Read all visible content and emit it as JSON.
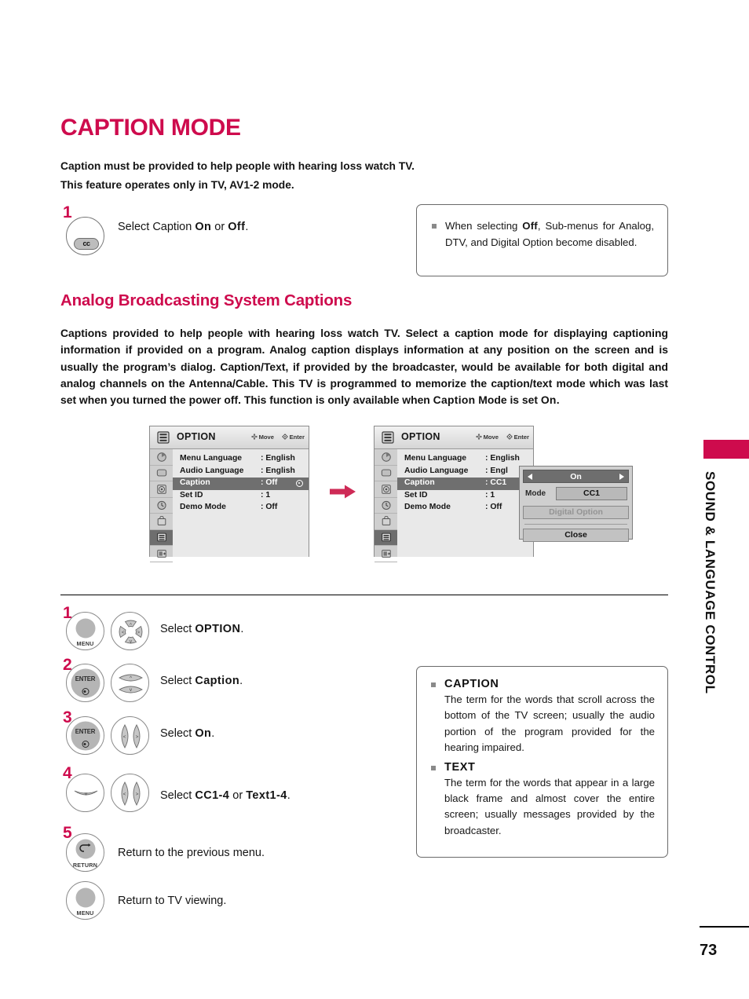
{
  "colors": {
    "accent": "#CE0B4D",
    "osd_highlight": "#6F6F6F",
    "text": "#151515"
  },
  "header": {
    "title": "CAPTION MODE"
  },
  "intro": {
    "line1": "Caption must be provided to help people with hearing loss watch TV.",
    "line2": "This feature operates only in TV, AV1-2 mode."
  },
  "top_step": {
    "number": "1",
    "button_label": "cc",
    "instruction_prefix": "Select Caption ",
    "instruction_on": "On",
    "instruction_mid": " or ",
    "instruction_off": "Off",
    "instruction_suffix": "."
  },
  "note_top": {
    "text_a": "When selecting ",
    "bold": "Off",
    "text_b": ", Sub-menus for Analog, DTV, and Digital Option become disabled."
  },
  "section": {
    "title": "Analog Broadcasting System Captions",
    "paragraph_a": "Captions provided to help people with hearing loss watch TV. Select a caption mode for displaying captioning information if provided on a program. Analog caption displays information at any position on the screen and is usually the program’s dialog. Caption/Text, if provided by the broadcaster, would be available for both digital and analog channels on the Antenna/Cable. This TV is programmed to memorize the caption/text mode which was last set when you turned the power off. This function is only available when ",
    "paragraph_bold1": "Caption",
    "paragraph_b": " Mode is set ",
    "paragraph_bold2": "On",
    "paragraph_c": "."
  },
  "osd": {
    "title": "OPTION",
    "hint_move": "Move",
    "hint_enter": "Enter",
    "rail_icons": [
      "picture-icon",
      "screen-icon",
      "audio-icon",
      "time-icon",
      "lock-icon",
      "option-icon",
      "input-icon"
    ],
    "rail_selected_index": 5,
    "screen1": {
      "rows": [
        {
          "label": "Menu Language",
          "value": ": English",
          "highlighted": false,
          "radio": false
        },
        {
          "label": "Audio Language",
          "value": ": English",
          "highlighted": false,
          "radio": false
        },
        {
          "label": "Caption",
          "value": ": Off",
          "highlighted": true,
          "radio": true
        },
        {
          "label": "Set ID",
          "value": ": 1",
          "highlighted": false,
          "radio": false
        },
        {
          "label": "Demo Mode",
          "value": ": Off",
          "highlighted": false,
          "radio": false
        }
      ]
    },
    "screen2": {
      "rows": [
        {
          "label": "Menu Language",
          "value": ": English",
          "highlighted": false,
          "radio": false
        },
        {
          "label": "Audio Language",
          "value": ": Engl",
          "highlighted": false,
          "radio": false
        },
        {
          "label": "Caption",
          "value": ": CC1",
          "highlighted": true,
          "radio": false
        },
        {
          "label": "Set ID",
          "value": ": 1",
          "highlighted": false,
          "radio": false
        },
        {
          "label": "Demo Mode",
          "value": ": Off",
          "highlighted": false,
          "radio": false
        }
      ],
      "popup": {
        "top_value": "On",
        "mode_label": "Mode",
        "mode_value": "CC1",
        "digital_option": "Digital Option",
        "close": "Close"
      }
    }
  },
  "steps": [
    {
      "number": "1",
      "button": "MENU",
      "wheel": "dpad4",
      "text_prefix": "Select ",
      "text_bold": "OPTION",
      "text_suffix": "."
    },
    {
      "number": "2",
      "button": "ENTER",
      "wheel": "updown",
      "text_prefix": "Select ",
      "text_bold": "Caption",
      "text_suffix": "."
    },
    {
      "number": "3",
      "button": "ENTER",
      "wheel": "leftright",
      "text_prefix": "Select ",
      "text_bold": "On",
      "text_suffix": "."
    },
    {
      "number": "4",
      "button": "down",
      "wheel": "leftright",
      "text_prefix": "Select ",
      "text_bold": "CC1-4",
      "text_mid": " or ",
      "text_bold2": "Text1-4",
      "text_suffix": "."
    }
  ],
  "return_steps": [
    {
      "number": "5",
      "button": "RETURN",
      "text": "Return to the previous menu."
    },
    {
      "number": "",
      "button": "MENU",
      "text": "Return to TV viewing."
    }
  ],
  "note_bottom": {
    "items": [
      {
        "head": "CAPTION",
        "body": "The term for the words that scroll across the bottom of the TV screen; usually the audio portion of the program provided for the hearing impaired."
      },
      {
        "head": "TEXT",
        "body": "The term for the words that appear in a large black frame and almost cover the entire screen; usually messages provided by the broadcaster."
      }
    ]
  },
  "side_tab": {
    "label": "SOUND & LANGUAGE CONTROL"
  },
  "footer": {
    "page_number": "73"
  }
}
